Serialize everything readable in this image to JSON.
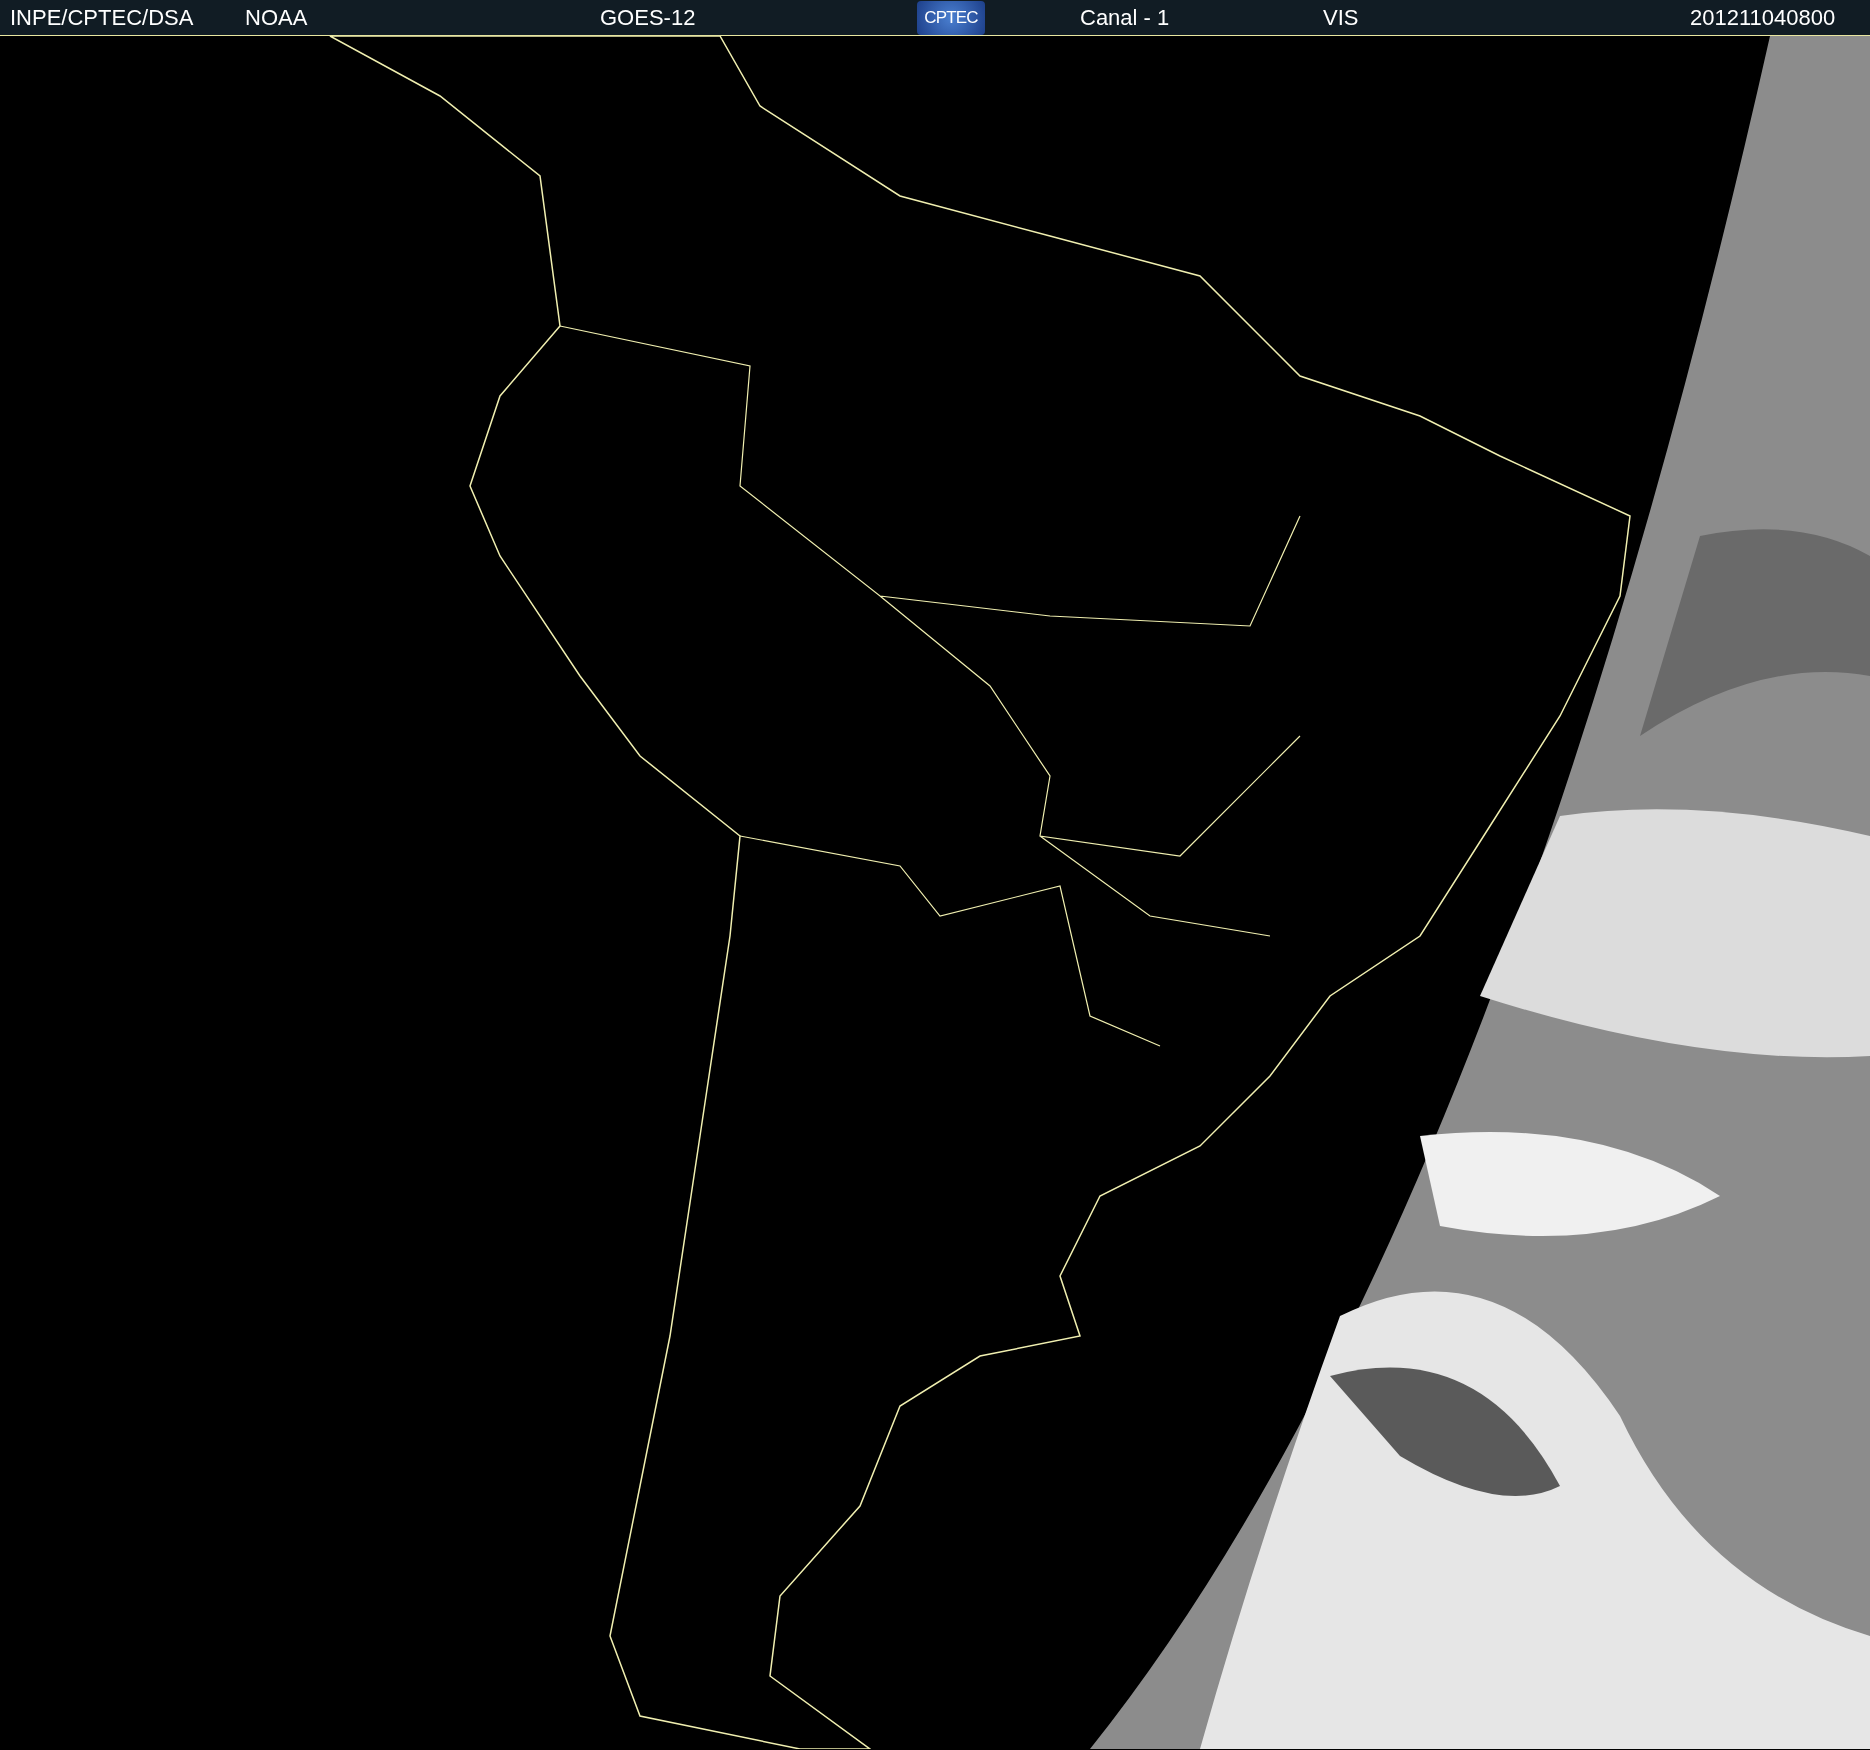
{
  "header": {
    "source": "INPE/CPTEC/DSA",
    "agency": "NOAA",
    "satellite": "GOES-12",
    "logo": "CPTEC",
    "channel": "Canal - 1",
    "band": "VIS",
    "timestamp": "201211040800"
  }
}
